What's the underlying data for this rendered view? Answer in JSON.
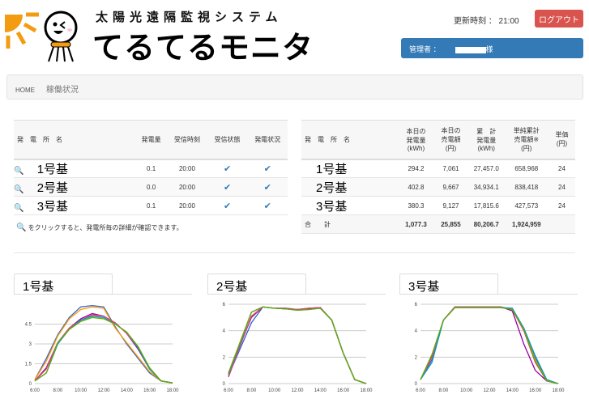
{
  "header": {
    "subtitle": "太陽光遠隔監視システム",
    "title": "てるてるモニタ",
    "updated_label": "更新時刻 ： 21:00",
    "logout_label": "ログアウト",
    "user_label": "管理者 ：",
    "user_suffix": "様"
  },
  "breadcrumb": {
    "home": "HOME",
    "current": "稼働状況"
  },
  "status_table": {
    "headers": [
      "発電所名",
      "発電量",
      "受信時刻",
      "受信状態",
      "発電状況"
    ],
    "rows": [
      {
        "name": "1号基",
        "gen": "0.1",
        "time": "20:00"
      },
      {
        "name": "2号基",
        "gen": "0.0",
        "time": "20:00"
      },
      {
        "name": "3号基",
        "gen": "0.1",
        "time": "20:00"
      }
    ],
    "note": "をクリックすると、発電所毎の詳細が確認できます。"
  },
  "summary_table": {
    "headers": [
      "発電所名",
      "本日の発電量(kWh)",
      "本日の売電額(円)",
      "累計発電量(kWh)",
      "単純累計売電額※(円)",
      "単価(円)"
    ],
    "header_lines": [
      [
        "本日の",
        "発電量",
        "(kWh)"
      ],
      [
        "本日の",
        "売電額",
        "(円)"
      ],
      [
        "累　計",
        "発電量",
        "(kWh)"
      ],
      [
        "単純累計",
        "売電額※",
        "(円)"
      ],
      [
        "単　価",
        "(円)"
      ]
    ],
    "rows": [
      {
        "name": "1号基",
        "cells": [
          "294.2",
          "7,061",
          "27,457.0",
          "658,968",
          "24"
        ]
      },
      {
        "name": "2号基",
        "cells": [
          "402.8",
          "9,667",
          "34,934.1",
          "838,418",
          "24"
        ]
      },
      {
        "name": "3号基",
        "cells": [
          "380.3",
          "9,127",
          "17,815.6",
          "427,573",
          "24"
        ]
      }
    ],
    "total": {
      "label": "合　計",
      "cells": [
        "1,077.3",
        "25,855",
        "80,206.7",
        "1,924,959",
        ""
      ]
    }
  },
  "colors": {
    "series": [
      "#3366cc",
      "#ff9900",
      "#990099",
      "#dd4477",
      "#0099c6",
      "#66aa00"
    ],
    "logout": "#d9534f",
    "userbar": "#337ab7"
  },
  "chart_data": [
    {
      "type": "line",
      "title": "1号基",
      "x": [
        "6:00",
        "7:00",
        "8:00",
        "9:00",
        "10:00",
        "11:00",
        "12:00",
        "13:00",
        "14:00",
        "15:00",
        "16:00",
        "17:00",
        "18:00"
      ],
      "xticks": [
        "6:00",
        "8:00",
        "10:00",
        "12:00",
        "14:00",
        "16:00",
        "18:00"
      ],
      "yticks": [
        0,
        1.5,
        3,
        4.5
      ],
      "ylim": [
        0,
        6
      ],
      "grid": true,
      "series": [
        {
          "values": [
            0.3,
            1.9,
            3.7,
            5.0,
            5.8,
            5.9,
            5.8,
            4.3,
            3.0,
            1.9,
            0.8,
            0.2,
            0.05
          ]
        },
        {
          "values": [
            0.3,
            1.7,
            3.6,
            4.9,
            5.6,
            5.8,
            5.7,
            4.2,
            3.1,
            2.0,
            0.9,
            0.2,
            0.05
          ]
        },
        {
          "values": [
            0.2,
            1.2,
            3.1,
            4.2,
            4.9,
            5.3,
            5.1,
            4.6,
            3.8,
            2.6,
            1.1,
            0.2,
            0.05
          ]
        },
        {
          "values": [
            0.2,
            1.1,
            3.1,
            4.2,
            4.8,
            5.2,
            5.1,
            4.6,
            3.8,
            2.7,
            1.1,
            0.2,
            0.05
          ]
        },
        {
          "values": [
            0.2,
            0.8,
            3.0,
            4.1,
            4.8,
            5.1,
            5.0,
            4.5,
            3.9,
            2.7,
            1.1,
            0.2,
            0.05
          ]
        },
        {
          "values": [
            0.2,
            0.8,
            3.1,
            4.1,
            4.7,
            5.0,
            4.9,
            4.5,
            3.9,
            2.8,
            1.2,
            0.2,
            0.05
          ]
        }
      ]
    },
    {
      "type": "line",
      "title": "2号基",
      "x": [
        "6:00",
        "7:00",
        "8:00",
        "9:00",
        "10:00",
        "11:00",
        "12:00",
        "13:00",
        "14:00",
        "15:00",
        "16:00",
        "17:00",
        "18:00"
      ],
      "xticks": [
        "6:00",
        "8:00",
        "10:00",
        "12:00",
        "14:00",
        "16:00",
        "18:00"
      ],
      "yticks": [
        0,
        2,
        4,
        6
      ],
      "ylim": [
        0,
        6
      ],
      "grid": true,
      "series": [
        {
          "values": [
            0.6,
            2.6,
            4.6,
            5.8,
            5.7,
            5.65,
            5.6,
            5.65,
            5.7,
            4.8,
            2.3,
            0.3,
            0
          ]
        },
        {
          "values": [
            0.8,
            3.1,
            5.4,
            5.8,
            5.7,
            5.7,
            5.6,
            5.7,
            5.7,
            4.8,
            2.3,
            0.3,
            0
          ]
        },
        {
          "values": [
            0.5,
            2.9,
            5.0,
            5.8,
            5.7,
            5.7,
            5.6,
            5.7,
            5.75,
            4.8,
            2.3,
            0.3,
            0
          ]
        },
        {
          "values": [
            0.5,
            2.8,
            5.1,
            5.8,
            5.7,
            5.7,
            5.6,
            5.7,
            5.75,
            4.8,
            2.3,
            0.3,
            0
          ]
        },
        {
          "values": [
            0.7,
            3.0,
            5.4,
            5.8,
            5.7,
            5.65,
            5.55,
            5.6,
            5.7,
            4.8,
            2.3,
            0.3,
            0
          ]
        },
        {
          "values": [
            0.8,
            3.1,
            5.4,
            5.8,
            5.7,
            5.65,
            5.55,
            5.6,
            5.7,
            4.8,
            2.3,
            0.3,
            0
          ]
        }
      ]
    },
    {
      "type": "line",
      "title": "3号基",
      "x": [
        "6:00",
        "7:00",
        "8:00",
        "9:00",
        "10:00",
        "11:00",
        "12:00",
        "13:00",
        "14:00",
        "15:00",
        "16:00",
        "17:00",
        "18:00"
      ],
      "xticks": [
        "6:00",
        "8:00",
        "10:00",
        "12:00",
        "14:00",
        "16:00",
        "18:00"
      ],
      "yticks": [
        0,
        2,
        4,
        6
      ],
      "ylim": [
        0,
        6
      ],
      "grid": true,
      "series": [
        {
          "values": [
            0.3,
            1.8,
            4.8,
            5.8,
            5.8,
            5.8,
            5.8,
            5.8,
            5.6,
            4.2,
            2.0,
            0.2,
            0
          ]
        },
        {
          "values": [
            0.3,
            2.0,
            4.8,
            5.8,
            5.8,
            5.8,
            5.8,
            5.8,
            5.6,
            4.1,
            1.8,
            0.2,
            0
          ]
        },
        {
          "values": [
            0.3,
            2.1,
            4.8,
            5.8,
            5.8,
            5.8,
            5.8,
            5.8,
            5.5,
            3.0,
            1.0,
            0.2,
            0
          ]
        },
        {
          "values": [
            0.3,
            2.0,
            4.8,
            5.8,
            5.8,
            5.8,
            5.8,
            5.8,
            5.6,
            4.0,
            1.6,
            0.2,
            0
          ]
        },
        {
          "values": [
            0.3,
            1.6,
            4.8,
            5.75,
            5.75,
            5.75,
            5.75,
            5.75,
            5.7,
            4.2,
            2.1,
            0.3,
            0
          ]
        },
        {
          "values": [
            0.3,
            2.2,
            4.8,
            5.75,
            5.75,
            5.75,
            5.75,
            5.75,
            5.6,
            4.1,
            1.7,
            0.2,
            0
          ]
        }
      ]
    }
  ]
}
